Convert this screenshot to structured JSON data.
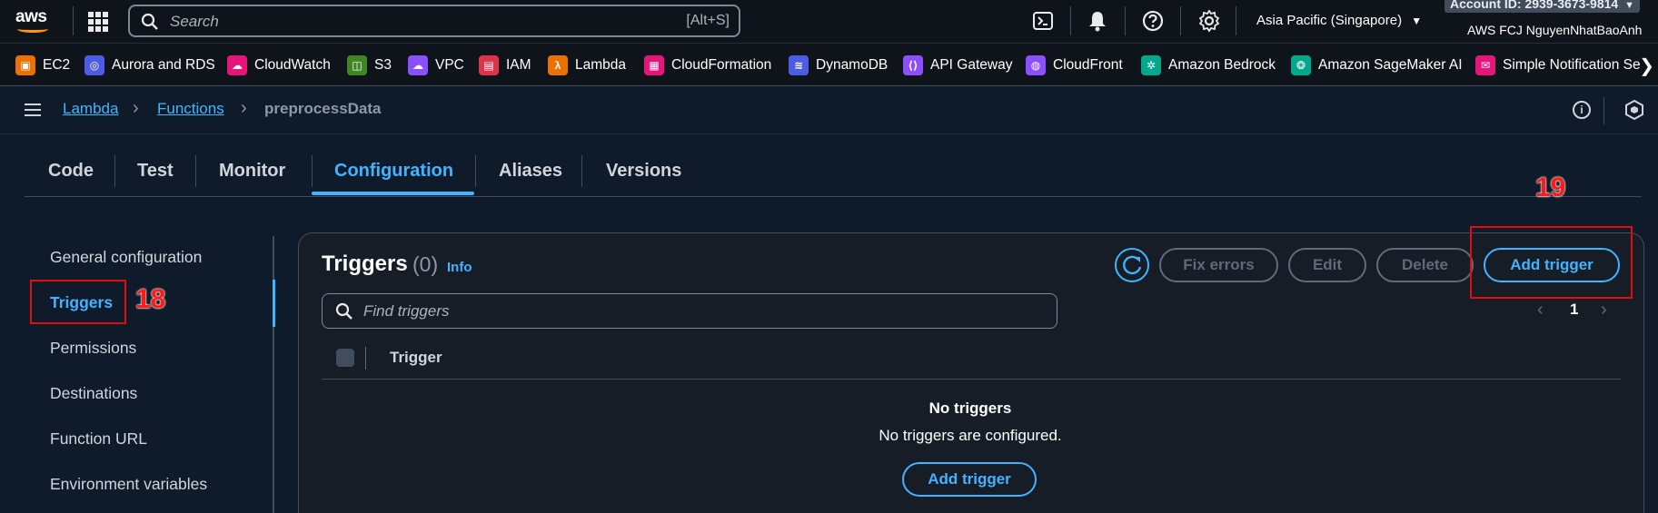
{
  "topbar": {
    "logo": "aws",
    "search_placeholder": "Search",
    "search_shortcut": "[Alt+S]",
    "region": "Asia Pacific (Singapore)",
    "account": "Account ID: 2939-3673-9814",
    "user": "AWS FCJ NguyenNhatBaoAnh",
    "icons": [
      "cloudshell-icon",
      "bell-icon",
      "help-icon",
      "settings-icon"
    ]
  },
  "favorites": [
    {
      "label": "EC2",
      "color": "#ed7100"
    },
    {
      "label": "Aurora and RDS",
      "color": "#4d5ce6"
    },
    {
      "label": "CloudWatch",
      "color": "#e7157b"
    },
    {
      "label": "S3",
      "color": "#3f8624"
    },
    {
      "label": "VPC",
      "color": "#8c4fff"
    },
    {
      "label": "IAM",
      "color": "#dd344c"
    },
    {
      "label": "Lambda",
      "color": "#ed7100"
    },
    {
      "label": "CloudFormation",
      "color": "#e7157b"
    },
    {
      "label": "DynamoDB",
      "color": "#4d5ce6"
    },
    {
      "label": "API Gateway",
      "color": "#8c4fff"
    },
    {
      "label": "CloudFront",
      "color": "#8c4fff"
    },
    {
      "label": "Amazon Bedrock",
      "color": "#01a88d"
    },
    {
      "label": "Amazon SageMaker AI",
      "color": "#01a88d"
    },
    {
      "label": "Simple Notification Se",
      "color": "#e7157b"
    }
  ],
  "breadcrumb": {
    "items": [
      "Lambda",
      "Functions"
    ],
    "current": "preprocessData"
  },
  "tabs": [
    "Code",
    "Test",
    "Monitor",
    "Configuration",
    "Aliases",
    "Versions"
  ],
  "active_tab": "Configuration",
  "sidenav": [
    "General configuration",
    "Triggers",
    "Permissions",
    "Destinations",
    "Function URL",
    "Environment variables"
  ],
  "panel": {
    "title": "Triggers",
    "count": "(0)",
    "info": "Info",
    "buttons": {
      "fix_errors": "Fix errors",
      "edit": "Edit",
      "delete": "Delete",
      "add_trigger": "Add trigger"
    },
    "find_placeholder": "Find triggers",
    "page": "1",
    "column": "Trigger",
    "empty_title": "No triggers",
    "empty_sub": "No triggers are configured.",
    "empty_button": "Add trigger"
  },
  "annotations": {
    "a18": "18",
    "a19": "19"
  }
}
